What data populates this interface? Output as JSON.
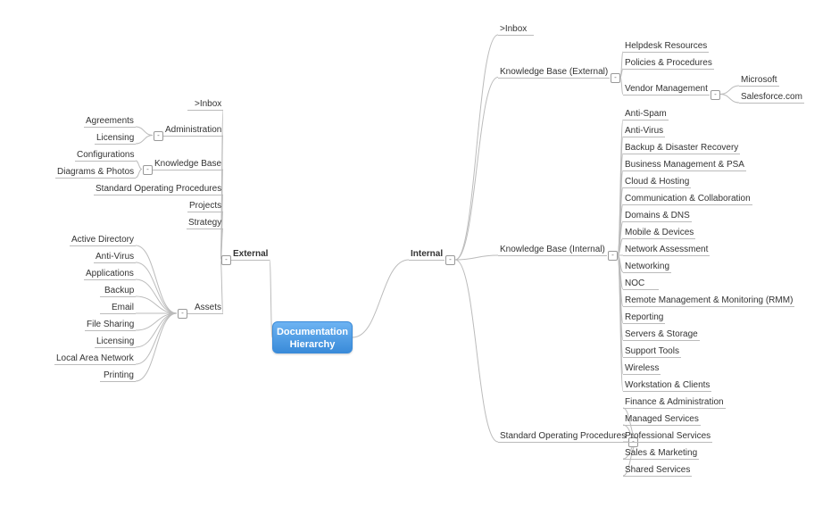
{
  "center": "Documentation\nHierarchy",
  "left": {
    "label": "External",
    "children": [
      {
        "label": ">Inbox"
      },
      {
        "label": "Administration",
        "children": [
          {
            "label": "Agreements"
          },
          {
            "label": "Licensing"
          }
        ]
      },
      {
        "label": "Knowledge Base",
        "children": [
          {
            "label": "Configurations"
          },
          {
            "label": "Diagrams & Photos"
          }
        ]
      },
      {
        "label": "Standard Operating Procedures"
      },
      {
        "label": "Projects"
      },
      {
        "label": "Strategy"
      },
      {
        "label": "Assets",
        "children": [
          {
            "label": "Active Directory"
          },
          {
            "label": "Anti-Virus"
          },
          {
            "label": "Applications"
          },
          {
            "label": "Backup"
          },
          {
            "label": "Email"
          },
          {
            "label": "File Sharing"
          },
          {
            "label": "Licensing"
          },
          {
            "label": "Local Area Network"
          },
          {
            "label": "Printing"
          }
        ]
      }
    ]
  },
  "right": {
    "label": "Internal",
    "children": [
      {
        "label": ">Inbox"
      },
      {
        "label": "Knowledge Base (External)",
        "children": [
          {
            "label": "Helpdesk Resources"
          },
          {
            "label": "Policies & Procedures"
          },
          {
            "label": "Vendor Management",
            "children": [
              {
                "label": "Microsoft"
              },
              {
                "label": "Salesforce.com"
              }
            ]
          }
        ]
      },
      {
        "label": "Knowledge Base (Internal)",
        "children": [
          {
            "label": "Anti-Spam"
          },
          {
            "label": "Anti-Virus"
          },
          {
            "label": "Backup & Disaster Recovery"
          },
          {
            "label": "Business Management & PSA"
          },
          {
            "label": "Cloud & Hosting"
          },
          {
            "label": "Communication & Collaboration"
          },
          {
            "label": "Domains & DNS"
          },
          {
            "label": "Mobile & Devices"
          },
          {
            "label": "Network Assessment"
          },
          {
            "label": "Networking"
          },
          {
            "label": "NOC"
          },
          {
            "label": "Remote Management & Monitoring (RMM)"
          },
          {
            "label": "Reporting"
          },
          {
            "label": "Servers & Storage"
          },
          {
            "label": "Support Tools"
          },
          {
            "label": "Wireless"
          },
          {
            "label": "Workstation & Clients"
          }
        ]
      },
      {
        "label": "Standard Operating Procedures",
        "children": [
          {
            "label": "Finance & Administration"
          },
          {
            "label": "Managed Services"
          },
          {
            "label": "Professional Services"
          },
          {
            "label": "Sales & Marketing"
          },
          {
            "label": "Shared Services"
          }
        ]
      }
    ]
  },
  "toggle_glyph": "-"
}
